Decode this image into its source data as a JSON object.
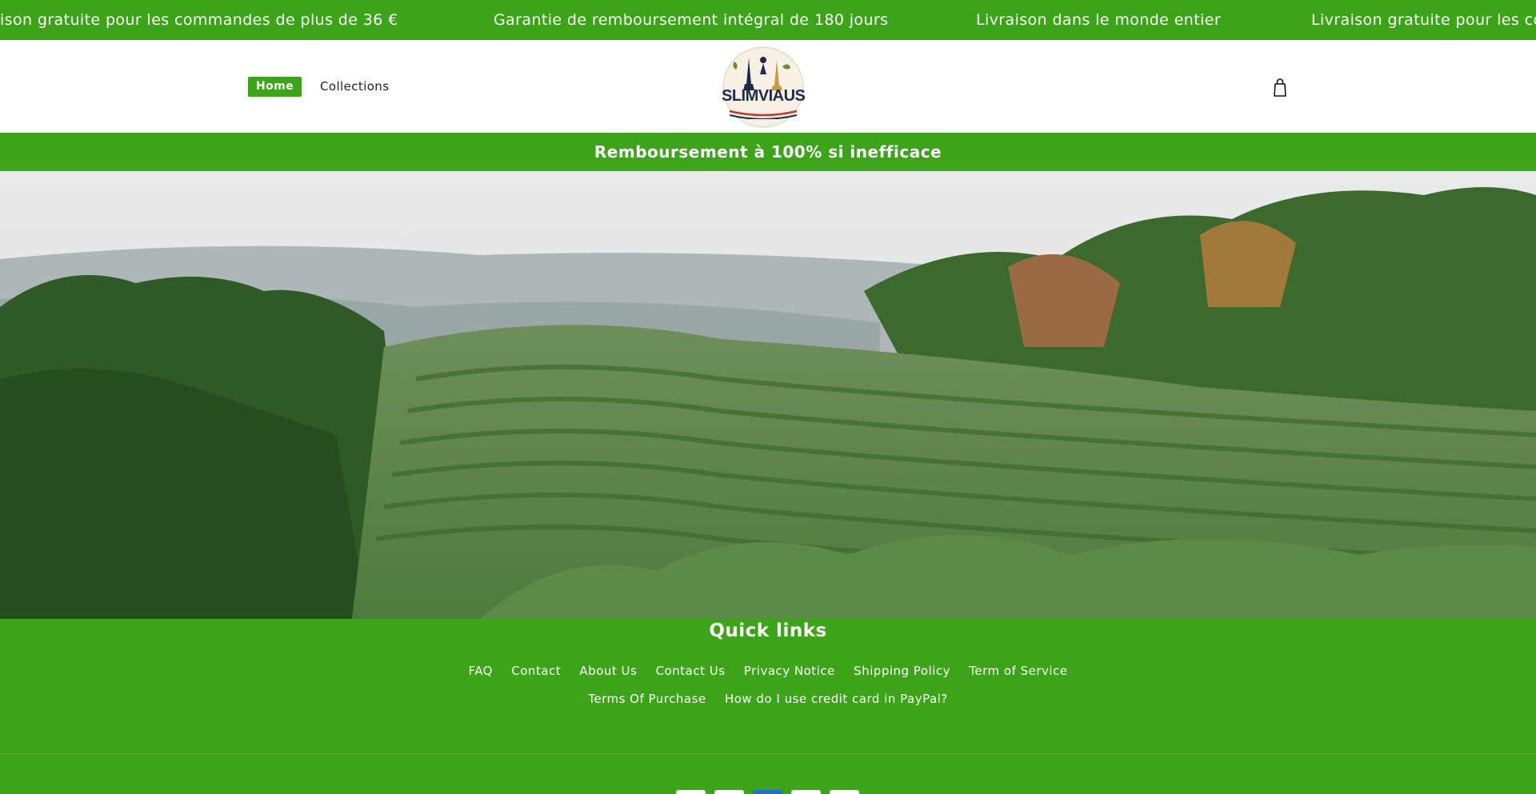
{
  "announcements": [
    "ison gratuite pour les commandes de plus de 36 €",
    "Garantie de remboursement intégral de 180 jours",
    "Livraison dans le monde entier",
    "Livraison gratuite pour les co"
  ],
  "header": {
    "nav": {
      "home": "Home",
      "collections": "Collections"
    },
    "logo_text": "SLIMVIAUS",
    "cart_icon": "shopping-bag-icon"
  },
  "banner": {
    "text": "Remboursement à 100% si inefficace"
  },
  "hero": {
    "alt": "tea plantation"
  },
  "footer": {
    "quick_links_title": "Quick links",
    "links_row1": [
      "FAQ",
      "Contact",
      "About Us",
      "Contact Us",
      "Privacy Notice",
      "Shipping Policy",
      "Term of Service"
    ],
    "links_row2": [
      "Terms Of Purchase",
      "How do I use credit card in PayPal?"
    ]
  },
  "colors": {
    "brand_green": "#3ca418",
    "logo_navy": "#1f2b4d",
    "logo_red": "#c0392b"
  }
}
